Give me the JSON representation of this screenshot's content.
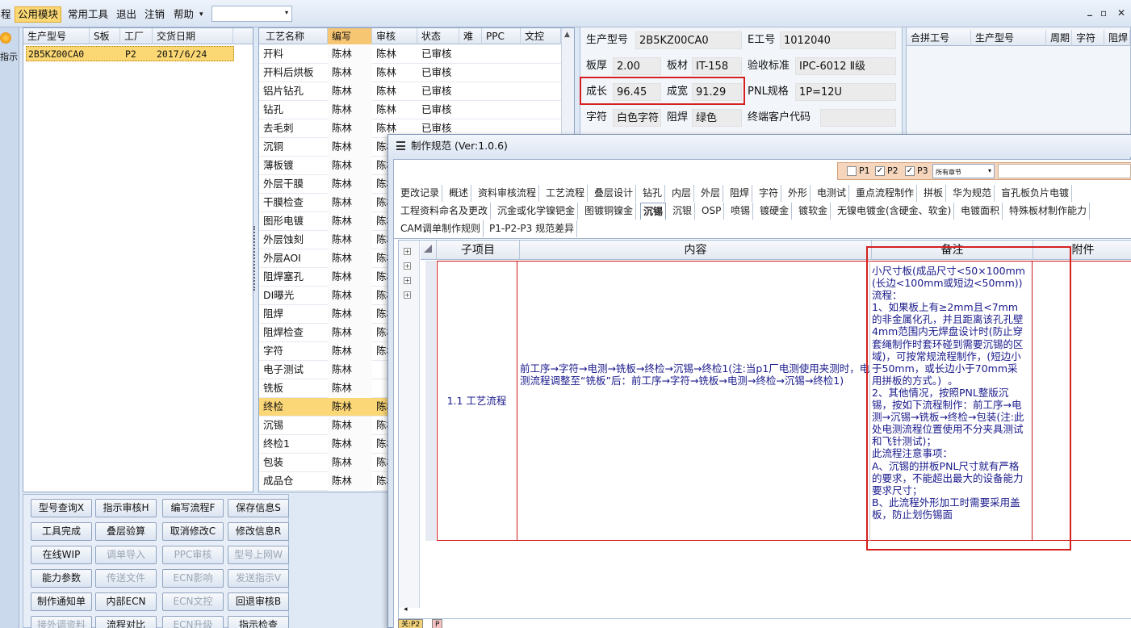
{
  "menubar": {
    "items": [
      "程",
      "公用模块",
      "常用工具",
      "退出",
      "注销",
      "帮助"
    ],
    "dropdown_arrow": "▾",
    "combo_value": "",
    "window_controls": [
      "_",
      "▫",
      "✕"
    ]
  },
  "rail": {
    "label": "指示"
  },
  "model_grid": {
    "headers": [
      "生产型号",
      "S板",
      "工厂",
      "交货日期"
    ],
    "rows": [
      [
        "2B5KZ00CA0",
        "",
        "P2",
        "2017/6/24"
      ]
    ]
  },
  "process_grid": {
    "headers": [
      "工艺名称",
      "编写",
      "审核",
      "状态",
      "难",
      "PPC",
      "文控"
    ],
    "rows": [
      [
        "开料",
        "陈林",
        "陈林",
        "已审核"
      ],
      [
        "开料后烘板",
        "陈林",
        "陈林",
        "已审核"
      ],
      [
        "铝片钻孔",
        "陈林",
        "陈林",
        "已审核"
      ],
      [
        "钻孔",
        "陈林",
        "陈林",
        "已审核"
      ],
      [
        "去毛刺",
        "陈林",
        "陈林",
        "已审核"
      ],
      [
        "沉铜",
        "陈林",
        "陈林",
        ""
      ],
      [
        "薄板镀",
        "陈林",
        "陈林",
        ""
      ],
      [
        "外层干膜",
        "陈林",
        "陈林",
        ""
      ],
      [
        "干膜检查",
        "陈林",
        "陈林",
        ""
      ],
      [
        "图形电镀",
        "陈林",
        "陈林",
        ""
      ],
      [
        "外层蚀刻",
        "陈林",
        "陈林",
        ""
      ],
      [
        "外层AOI",
        "陈林",
        "陈林",
        ""
      ],
      [
        "阻焊塞孔",
        "陈林",
        "陈林",
        ""
      ],
      [
        "DI曝光",
        "陈林",
        "陈林",
        ""
      ],
      [
        "阻焊",
        "陈林",
        "陈林",
        ""
      ],
      [
        "阻焊检查",
        "陈林",
        "陈林",
        ""
      ],
      [
        "字符",
        "陈林",
        "陈林",
        ""
      ],
      [
        "电子测试",
        "陈林",
        "",
        ""
      ],
      [
        "铣板",
        "陈林",
        "",
        ""
      ],
      [
        "终检",
        "陈林",
        "陈林",
        ""
      ],
      [
        "沉锡",
        "陈林",
        "陈林",
        ""
      ],
      [
        "终检1",
        "陈林",
        "陈林",
        ""
      ],
      [
        "包装",
        "陈林",
        "陈林",
        ""
      ],
      [
        "成品仓",
        "陈林",
        "陈林",
        ""
      ]
    ],
    "selected_index": 19,
    "scroll_up": "▲"
  },
  "info": {
    "model_label": "生产型号",
    "model_value": "2B5KZ00CA0",
    "eno_label": "E工号",
    "eno_value": "1012040",
    "thick_label": "板厚",
    "thick_value": "2.00",
    "material_label": "板材",
    "material_value": "IT-158",
    "standard_label": "验收标准",
    "standard_value": "IPC-6012 Ⅱ级",
    "len_label": "成长",
    "len_value": "96.45",
    "wid_label": "成宽",
    "wid_value": "91.29",
    "pnl_label": "PNL规格",
    "pnl_value": "1P=12U",
    "char_label": "字符",
    "char_value": "白色字符",
    "mask_label": "阻焊",
    "mask_value": "绿色",
    "cust_label": "终端客户代码",
    "cust_value": ""
  },
  "merge_grid": {
    "headers": [
      "合拼工号",
      "生产型号",
      "周期",
      "字符",
      "阻焊"
    ]
  },
  "buttons": [
    {
      "label": "型号查询X",
      "enabled": true
    },
    {
      "label": "指示审核H",
      "enabled": true
    },
    {
      "label": "编写流程F",
      "enabled": true
    },
    {
      "label": "保存信息S",
      "enabled": true
    },
    {
      "label": "工具完成",
      "enabled": true
    },
    {
      "label": "叠层验算",
      "enabled": true
    },
    {
      "label": "取消修改C",
      "enabled": true
    },
    {
      "label": "修改信息R",
      "enabled": true
    },
    {
      "label": "在线WIP",
      "enabled": true
    },
    {
      "label": "调单导入",
      "enabled": false
    },
    {
      "label": "PPC审核",
      "enabled": false
    },
    {
      "label": "型号上网W",
      "enabled": false
    },
    {
      "label": "能力参数",
      "enabled": true
    },
    {
      "label": "传送文件",
      "enabled": false
    },
    {
      "label": "ECN影响",
      "enabled": false
    },
    {
      "label": "发送指示V",
      "enabled": false
    },
    {
      "label": "制作通知单",
      "enabled": true
    },
    {
      "label": "内部ECN",
      "enabled": true
    },
    {
      "label": "ECN文控",
      "enabled": false
    },
    {
      "label": "回退审核B",
      "enabled": true
    },
    {
      "label": "接外调资料",
      "enabled": false
    },
    {
      "label": "流程对比",
      "enabled": true
    },
    {
      "label": "ECN升级",
      "enabled": false
    },
    {
      "label": "指示检查",
      "enabled": true
    }
  ],
  "spec": {
    "title": "制作规范 (Ver:1.0.6)",
    "filters": [
      {
        "label": "P1",
        "checked": false
      },
      {
        "label": "P2",
        "checked": true
      },
      {
        "label": "P3",
        "checked": true
      }
    ],
    "chapter_value": "所有章节",
    "chapter_arrow": "▾",
    "check_mark": "✓",
    "tabs_row1": [
      "更改记录",
      "概述",
      "资料审核流程",
      "工艺流程",
      "叠层设计",
      "钻孔",
      "内层",
      "外层",
      "阻焊",
      "字符",
      "外形",
      "电测试",
      "重点流程制作",
      "拼板",
      "华为规范",
      "盲孔板负片电镀"
    ],
    "tabs_row2": [
      "工程资料命名及更改",
      "沉金或化学镍钯金",
      "图镀铜镍金",
      "沉锡",
      "沉银",
      "OSP",
      "喷锡",
      "镀硬金",
      "镀软金",
      "无镍电镀金(含硬金、软金)",
      "电镀面积",
      "特殊板材制作能力"
    ],
    "tabs_row3": [
      "CAM调单制作规则",
      "P1-P2-P3 规范差异"
    ],
    "active_tab": "沉锡",
    "grid_headers": [
      "子项目",
      "内容",
      "备注",
      "附件"
    ],
    "plus_sign": "+",
    "left_arrow": "◂",
    "row": {
      "subitem": "1.1 工艺流程",
      "content": "前工序→字符→电测→铣板→终检→沉锡→终检1(注:当p1厂电测使用夹测时，电测流程调整至“铣板”后：前工序→字符→铣板→电测→终检→沉锡→终检1)",
      "note": "小尺寸板(成品尺寸<50×100mm(长边<100mm或短边<50mm))流程：\n1、如果板上有≥2mm且<7mm的非金属化孔，并且距离该孔孔壁4mm范围内无焊盘设计时(防止穿套绳制作时套环碰到需要沉锡的区域)，可按常规流程制作，(短边小于50mm，或长边小于70mm采用拼板的方式。)  。\n2、其他情况，按照PNL整版沉锡，按如下流程制作：前工序→电测→沉锡→铣板→终检→包装(注:此处电测流程位置使用不分夹具测试和飞针测试)；\n此流程注意事项：\nA、沉锡的拼板PNL尺寸就有严格的要求，不能超出最大的设备能力要求尺寸；\nB、此流程外形加工时需要采用盖板，防止划伤锡面"
    },
    "footer": [
      "关:P2",
      "P"
    ]
  }
}
